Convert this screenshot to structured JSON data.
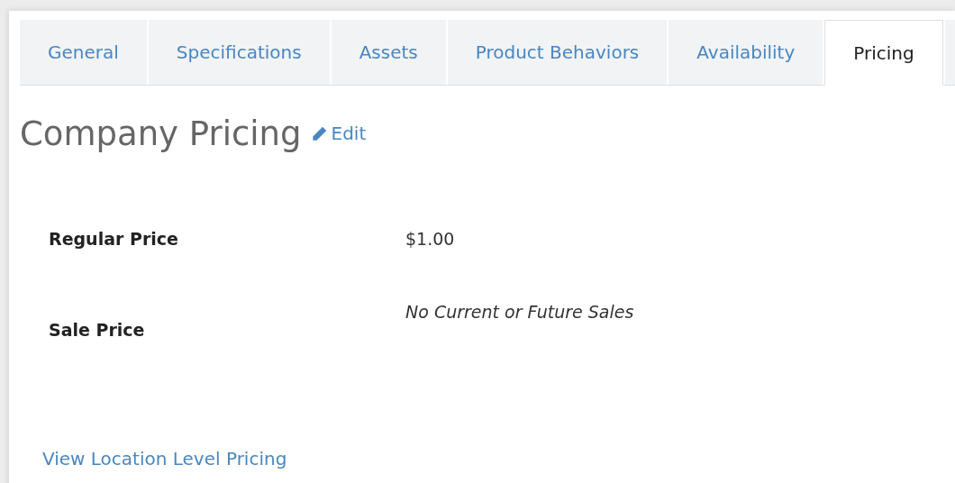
{
  "tabs": [
    {
      "label": "General",
      "selected": false
    },
    {
      "label": "Specifications",
      "selected": false
    },
    {
      "label": "Assets",
      "selected": false
    },
    {
      "label": "Product Behaviors",
      "selected": false
    },
    {
      "label": "Availability",
      "selected": false
    },
    {
      "label": "Pricing",
      "selected": true
    }
  ],
  "heading": "Company Pricing",
  "edit_link": "Edit",
  "prices": [
    {
      "label": "Regular Price",
      "value": "$1.00",
      "kind": "amount"
    },
    {
      "label": "Sale Price",
      "value": "No Current or Future Sales",
      "kind": "note"
    }
  ],
  "footer_link": "View Location Level Pricing"
}
